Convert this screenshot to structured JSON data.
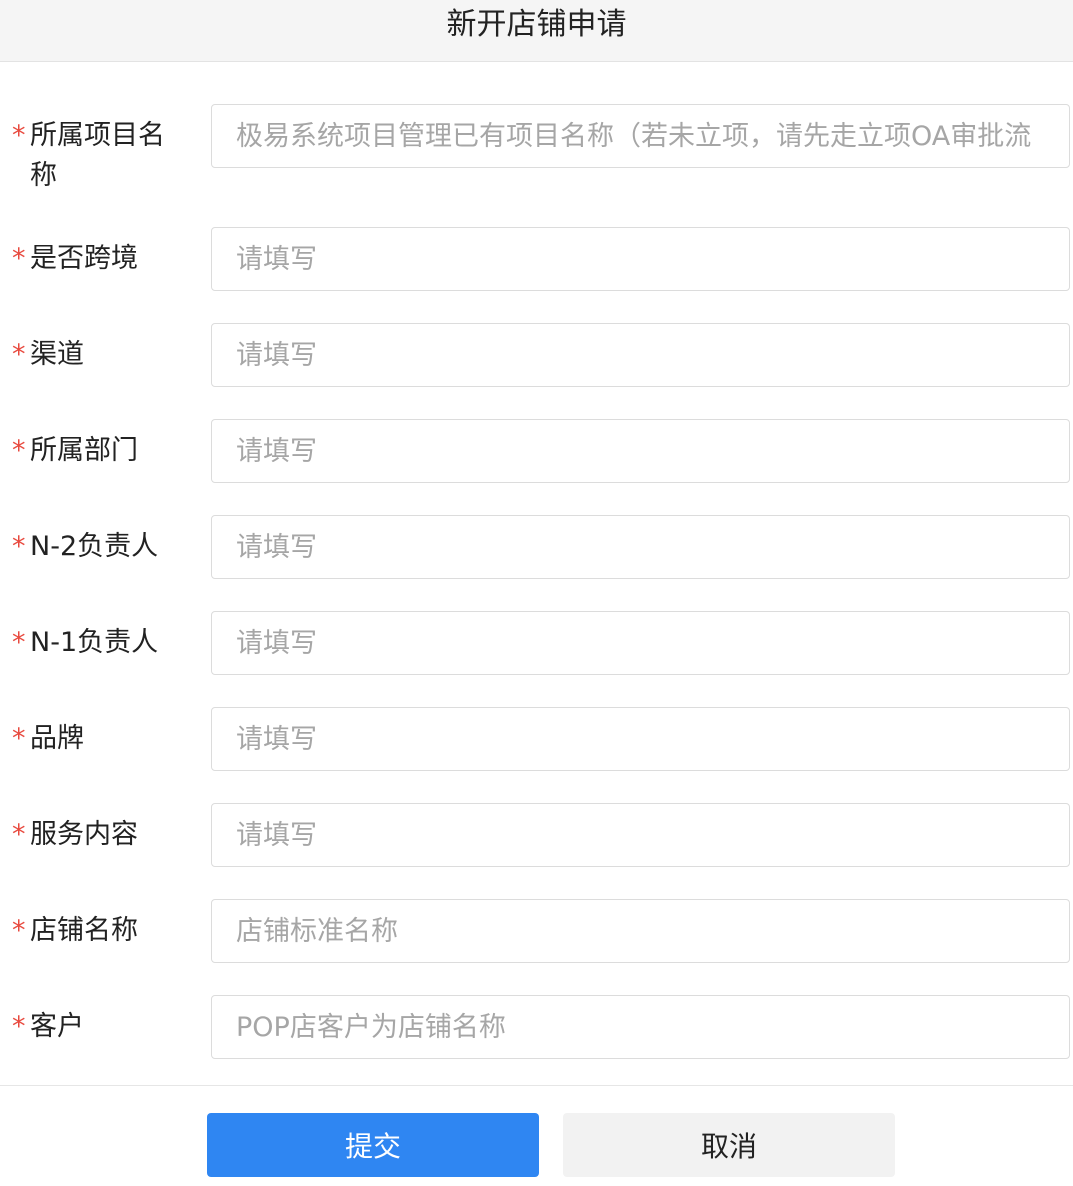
{
  "header": {
    "title": "新开店铺申请"
  },
  "form": {
    "required_mark": "*",
    "fields": [
      {
        "label": "所属项目名称",
        "placeholder": "极易系统项目管理已有项目名称（若未立项，请先走立项OA审批流",
        "value": ""
      },
      {
        "label": "是否跨境",
        "placeholder": "请填写",
        "value": ""
      },
      {
        "label": "渠道",
        "placeholder": "请填写",
        "value": ""
      },
      {
        "label": "所属部门",
        "placeholder": "请填写",
        "value": ""
      },
      {
        "label": "N-2负责人",
        "placeholder": "请填写",
        "value": ""
      },
      {
        "label": "N-1负责人",
        "placeholder": "请填写",
        "value": ""
      },
      {
        "label": "品牌",
        "placeholder": "请填写",
        "value": ""
      },
      {
        "label": "服务内容",
        "placeholder": "请填写",
        "value": ""
      },
      {
        "label": "店铺名称",
        "placeholder": "店铺标准名称",
        "value": ""
      },
      {
        "label": "客户",
        "placeholder": "POP店客户为店铺名称",
        "value": ""
      }
    ]
  },
  "actions": {
    "submit_label": "提交",
    "cancel_label": "取消"
  },
  "colors": {
    "primary": "#2f86f2",
    "required": "#e84a3f",
    "header_bg": "#f5f5f5",
    "border": "#dcdcdc",
    "placeholder": "#a6a6a6"
  }
}
